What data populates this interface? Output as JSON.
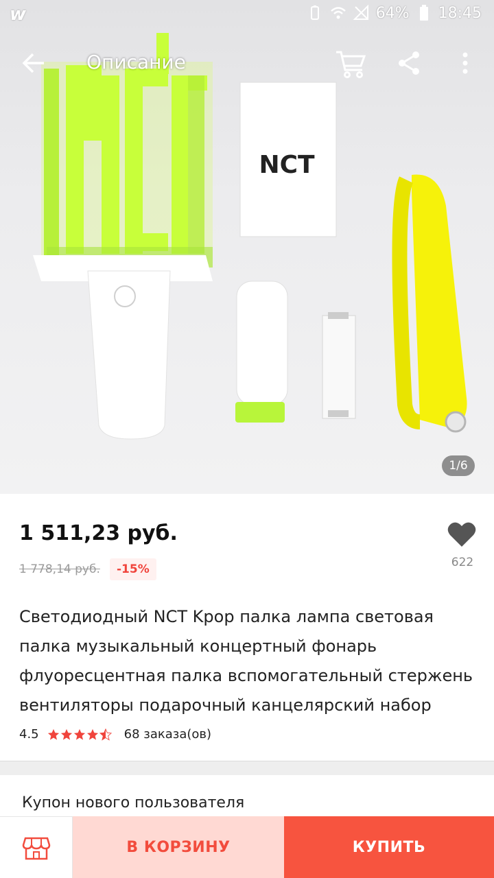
{
  "status_bar": {
    "app_logo": "w",
    "battery": "64%",
    "time": "18:45"
  },
  "toolbar": {
    "title": "Описание",
    "icons": [
      "back-arrow-icon",
      "cart-icon",
      "share-icon",
      "more-vert-icon"
    ]
  },
  "gallery": {
    "counter": "1/6",
    "logo_text": "NCT"
  },
  "product": {
    "price": "1 511,23 руб.",
    "old_price": "1 778,14 руб.",
    "discount": "-15%",
    "wishlist_count": "622",
    "title": "Светодиодный NCT Kpop палка лампа световая палка музыкальный концертный фонарь флуоресцентная палка вспомогательный стержень вентиляторы подарочный канцелярский набор",
    "rating": "4.5",
    "orders": "68 заказа(ов)"
  },
  "coupon": {
    "label": "Купон нового пользователя"
  },
  "actions": {
    "add_to_cart": "В КОРЗИНУ",
    "buy": "КУПИТЬ"
  },
  "colors": {
    "accent": "#f7543f",
    "accent_light": "#ffd9d3",
    "star": "#f0443c",
    "neon": "#c8ff3a"
  }
}
